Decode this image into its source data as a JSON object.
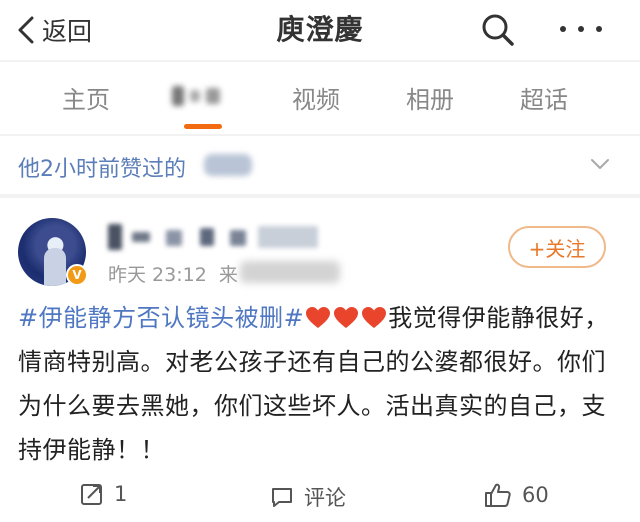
{
  "header": {
    "back_label": "返回",
    "title": "庾澄慶"
  },
  "tabs": [
    {
      "label": "主页"
    },
    {
      "label": "视频"
    },
    {
      "label": "相册"
    },
    {
      "label": "超话"
    }
  ],
  "liked_bar": {
    "text": "他2小时前赞过的"
  },
  "post": {
    "time": "昨天 23:12",
    "from_prefix": "来",
    "follow_label": "+关注",
    "hashtag": "#伊能静方否认镜头被删#",
    "text_after_hearts": "我觉得伊能静很好，情商特别高。对老公孩子还有自己的公婆都很好。你们为什么要去黑她，你们这些坏人。活出真实的自己，支持伊能静！！",
    "badge_icon": "verified-v-icon",
    "heart_color": "#e8452c"
  },
  "actions": {
    "repost_count": "1",
    "comment_label": "评论",
    "like_count": "60"
  },
  "colors": {
    "accent": "#f26a12",
    "link_blue": "#4f77c2"
  }
}
